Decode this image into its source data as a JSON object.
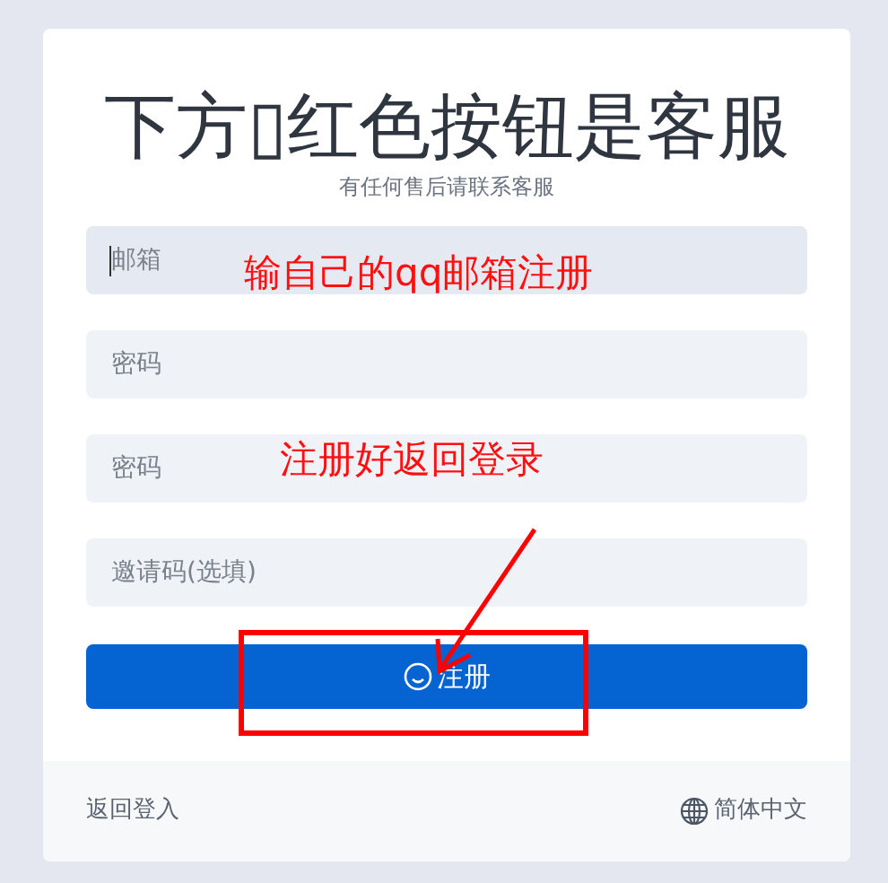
{
  "title": "下方▯红色按钮是客服",
  "subtitle": "有任何售后请联系客服",
  "fields": [
    {
      "placeholder": "邮箱",
      "focused": true
    },
    {
      "placeholder": "密码",
      "focused": false
    },
    {
      "placeholder": "密码",
      "focused": false
    },
    {
      "placeholder": "邀请码(选填)",
      "focused": false
    }
  ],
  "submit_button": {
    "label": "注册"
  },
  "footer": {
    "back_link": "返回登入",
    "language": "简体中文"
  },
  "annotations": [
    {
      "kind": "note",
      "text": "输自己的qq邮箱注册"
    },
    {
      "kind": "note",
      "text": "注册好返回登录"
    },
    {
      "kind": "arrow"
    },
    {
      "kind": "frame"
    }
  ]
}
